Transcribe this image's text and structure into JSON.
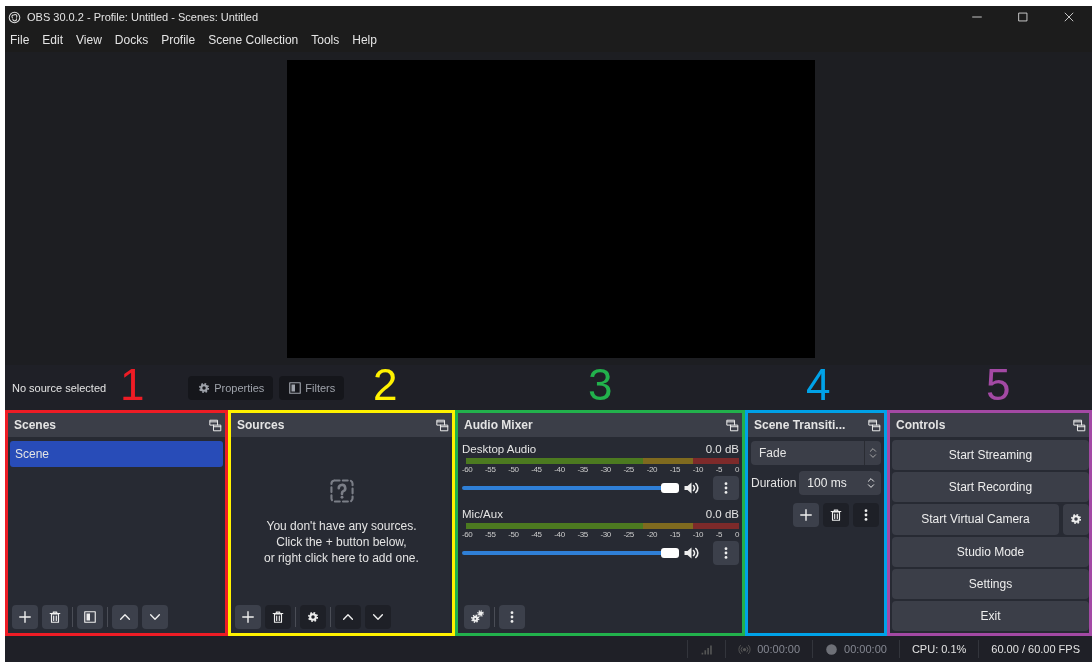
{
  "window": {
    "title": "OBS 30.0.2 - Profile: Untitled - Scenes: Untitled"
  },
  "menu": [
    "File",
    "Edit",
    "View",
    "Docks",
    "Profile",
    "Scene Collection",
    "Tools",
    "Help"
  ],
  "source_toolbar": {
    "status": "No source selected",
    "buttons": [
      {
        "label": "Properties",
        "kind": "gear"
      },
      {
        "label": "Filters",
        "kind": "filter"
      }
    ]
  },
  "scenes": {
    "title": "Scenes",
    "annotation": {
      "label": "1",
      "color": "#ee1c25"
    },
    "items": [
      {
        "label": "Scene",
        "selected": true
      }
    ],
    "tools": [
      {
        "kind": "plus",
        "disabled": false
      },
      {
        "kind": "trash",
        "disabled": false
      },
      {
        "kind": "filter",
        "disabled": false
      },
      {
        "kind": "up",
        "disabled": false
      },
      {
        "kind": "down",
        "disabled": false
      }
    ]
  },
  "sources": {
    "title": "Sources",
    "annotation": {
      "label": "2",
      "color": "#fff200"
    },
    "empty_message": "You don't have any sources.\nClick the + button below,\nor right click here to add one.",
    "tools": [
      {
        "kind": "plus",
        "disabled": false
      },
      {
        "kind": "trash",
        "disabled": true
      },
      {
        "kind": "gear",
        "disabled": true
      },
      {
        "kind": "up",
        "disabled": true
      },
      {
        "kind": "down",
        "disabled": true
      }
    ]
  },
  "mixer": {
    "title": "Audio Mixer",
    "annotation": {
      "label": "3",
      "color": "#22b14c"
    },
    "channels": [
      {
        "name": "Desktop Audio",
        "reading": "0.0 dB",
        "level": 1,
        "scale": [
          "-60",
          "-55",
          "-50",
          "-45",
          "-40",
          "-35",
          "-30",
          "-25",
          "-20",
          "-15",
          "-10",
          "-5",
          "0"
        ]
      },
      {
        "name": "Mic/Aux",
        "reading": "0.0 dB",
        "level": 1,
        "scale": [
          "-60",
          "-55",
          "-50",
          "-45",
          "-40",
          "-35",
          "-30",
          "-25",
          "-20",
          "-15",
          "-10",
          "-5",
          "0"
        ]
      }
    ],
    "tools": [
      {
        "kind": "gears",
        "disabled": false
      },
      {
        "kind": "dots",
        "disabled": false
      }
    ]
  },
  "transitions": {
    "title": "Scene Transiti...",
    "annotation": {
      "label": "4",
      "color": "#00a2e8"
    },
    "transition": "Fade",
    "duration_label": "Duration",
    "duration": "100 ms",
    "tools": [
      {
        "kind": "plus",
        "disabled": false
      },
      {
        "kind": "trash",
        "disabled": true
      },
      {
        "kind": "dots",
        "disabled": true
      }
    ]
  },
  "controls": {
    "title": "Controls",
    "annotation": {
      "label": "5",
      "color": "#a349a4"
    },
    "buttons": [
      {
        "label": "Start Streaming",
        "settings": false
      },
      {
        "label": "Start Recording",
        "settings": false
      },
      {
        "label": "Start Virtual Camera",
        "settings": true
      },
      {
        "label": "Studio Mode",
        "settings": false
      },
      {
        "label": "Settings",
        "settings": false
      },
      {
        "label": "Exit",
        "settings": false
      }
    ]
  },
  "status_bar": [
    {
      "kind": "signal"
    },
    {
      "kind": "broadcast",
      "text": "00:00:00"
    },
    {
      "kind": "record",
      "text": "00:00:00"
    },
    {
      "kind": "text",
      "text": "CPU: 0.1%"
    },
    {
      "kind": "text",
      "text": "60.00 / 60.00 FPS"
    }
  ]
}
